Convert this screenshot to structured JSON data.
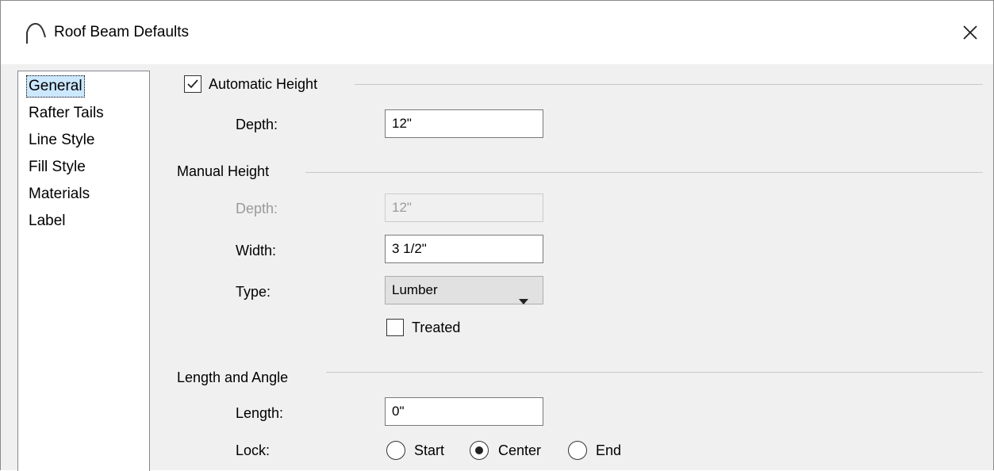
{
  "window": {
    "title": "Roof Beam Defaults",
    "title_icon": "roof-beam-arc-icon",
    "close_icon": "close-icon"
  },
  "sidebar": {
    "items": [
      {
        "label": "General",
        "selected": true
      },
      {
        "label": "Rafter Tails",
        "selected": false
      },
      {
        "label": "Line Style",
        "selected": false
      },
      {
        "label": "Fill Style",
        "selected": false
      },
      {
        "label": "Materials",
        "selected": false
      },
      {
        "label": "Label",
        "selected": false
      }
    ]
  },
  "automatic_height": {
    "checkbox_label": "Automatic Height",
    "checked": true,
    "depth_label": "Depth:",
    "depth_value": "12\""
  },
  "manual_height": {
    "section_label": "Manual Height",
    "depth_label": "Depth:",
    "depth_value": "12\"",
    "depth_disabled": true,
    "width_label": "Width:",
    "width_value": "3 1/2\"",
    "type_label": "Type:",
    "type_value": "Lumber",
    "treated_label": "Treated",
    "treated_checked": false
  },
  "length_angle": {
    "section_label": "Length and Angle",
    "length_label": "Length:",
    "length_value": "0\"",
    "lock_label": "Lock:",
    "lock_options": [
      {
        "label": "Start",
        "selected": false
      },
      {
        "label": "Center",
        "selected": true
      },
      {
        "label": "End",
        "selected": false
      }
    ]
  }
}
